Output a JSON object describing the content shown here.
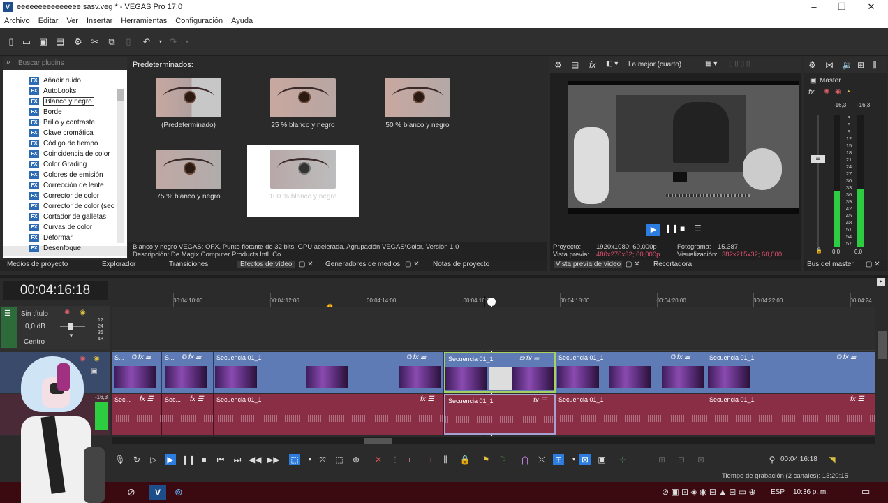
{
  "window": {
    "title": "eeeeeeeeeeeeeee sasv.veg * - VEGAS Pro 17.0",
    "logo": "V"
  },
  "menu": [
    "Archivo",
    "Editar",
    "Ver",
    "Insertar",
    "Herramientas",
    "Configuración",
    "Ayuda"
  ],
  "fx_panel": {
    "search_placeholder": "Buscar plugins",
    "items": [
      "Añadir ruido",
      "AutoLooks",
      "Blanco y negro",
      "Borde",
      "Brillo y contraste",
      "Clave cromática",
      "Código de tiempo",
      "Coincidencia de color",
      "Color Grading",
      "Colores de emisión",
      "Corrección de lente",
      "Corrector de color",
      "Corrector de color (sec",
      "Cortador de galletas",
      "Curvas de color",
      "Deformar",
      "Desenfoque"
    ],
    "selected": "Blanco y negro",
    "icon_label": "FX"
  },
  "presets": {
    "header": "Predeterminados:",
    "items": [
      "(Predeterminado)",
      "25 % blanco y negro",
      "50 % blanco y negro",
      "75 % blanco y negro",
      "100 % blanco y negro"
    ],
    "description_line1": "Blanco y negro VEGAS: OFX, Punto flotante de 32 bits, GPU acelerada, Agrupación VEGAS\\Color, Versión 1.0",
    "description_line2": "Descripción: De Magix Computer Products Intl. Co."
  },
  "bottom_tabs": [
    "Medios de proyecto",
    "Explorador",
    "Transiciones",
    "Efectos de vídeo",
    "Generadores de medios",
    "Notas de proyecto"
  ],
  "preview": {
    "quality": "La mejor (cuarto)",
    "project_label": "Proyecto:",
    "project_value": "1920x1080; 60,000p",
    "vista_label": "Vista previa:",
    "vista_value": "480x270x32; 60,000p",
    "frame_label": "Fotograma:",
    "frame_value": "15.387",
    "visual_label": "Visualización:",
    "visual_value": "382x215x32; 60,000",
    "tabs": [
      "Vista previa de vídeo",
      "Recortadora"
    ]
  },
  "mixer": {
    "title": "Master",
    "left_peak": "-16,3",
    "right_peak": "-16,3",
    "scale": [
      "3",
      "6",
      "9",
      "12",
      "15",
      "18",
      "21",
      "24",
      "27",
      "30",
      "33",
      "36",
      "39",
      "42",
      "45",
      "48",
      "51",
      "54",
      "57"
    ],
    "left_val": "0,0",
    "right_val": "0,0",
    "tab": "Bus del master",
    "level_left": 0.42,
    "level_right": 0.44
  },
  "timeline": {
    "timecode": "00:04:16:18",
    "ticks": [
      "00:04:10:00",
      "00:04:12:00",
      "00:04:14:00",
      "00:04:16:00",
      "00:04:18:00",
      "00:04:20:00",
      "00:04:22:00",
      "00:04:24"
    ],
    "track1": {
      "name": "Sin título",
      "volume": "0,0 dB",
      "pan": "Centro",
      "scale": [
        "12",
        "24",
        "36",
        "48"
      ]
    },
    "video_events": [
      "S...",
      "S...",
      "Secuencia 01_1",
      "Secuencia 01_1",
      "Secuencia 01_1",
      "Secuencia 01_1",
      "Secuencia 01_1"
    ],
    "audio_events": [
      "Sec...",
      "Sec...",
      "Secuencia 01_1",
      "Secuencia 01_1",
      "Secuencia 01_1",
      "Secuencia 01_1"
    ],
    "audio_level": "-16,3",
    "cursor_time": "00:04:16:18"
  },
  "status": {
    "record": "Tiempo de grabación (2 canales): 13:20:15"
  },
  "taskbar": {
    "lang": "ESP",
    "time": "10:36 p. m."
  }
}
